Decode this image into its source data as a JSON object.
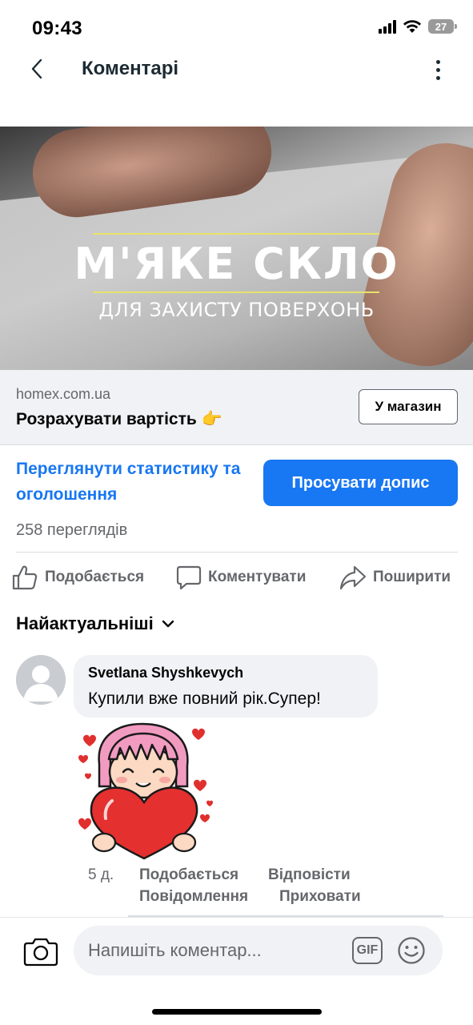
{
  "status_bar": {
    "time": "09:43",
    "battery": "27"
  },
  "header": {
    "title": "Коментарі"
  },
  "ad": {
    "image_title": "М'ЯКЕ СКЛО",
    "image_subtitle": "ДЛЯ ЗАХИСТУ ПОВЕРХОНЬ",
    "domain": "homex.com.ua",
    "headline": "Розрахувати вартість 👉",
    "cta_label": "У магазин"
  },
  "insights": {
    "link_text": "Переглянути статистику та оголошення",
    "boost_label": "Просувати допис",
    "views": "258 переглядів"
  },
  "actions": {
    "like": "Подобається",
    "comment": "Коментувати",
    "share": "Поширити"
  },
  "sort": {
    "label": "Найактуальніші"
  },
  "comment": {
    "author": "Svetlana Shyshkevych",
    "text": "Купили вже повний рік.Супер!",
    "age": "5 д.",
    "like": "Подобається",
    "reply": "Відповісти",
    "message": "Повідомлення",
    "hide": "Приховати"
  },
  "composer": {
    "placeholder": "Напишіть коментар...",
    "gif_label": "GIF"
  },
  "colors": {
    "accent": "#1877f2",
    "secondary_text": "#65676b",
    "bubble": "#f0f2f5"
  }
}
